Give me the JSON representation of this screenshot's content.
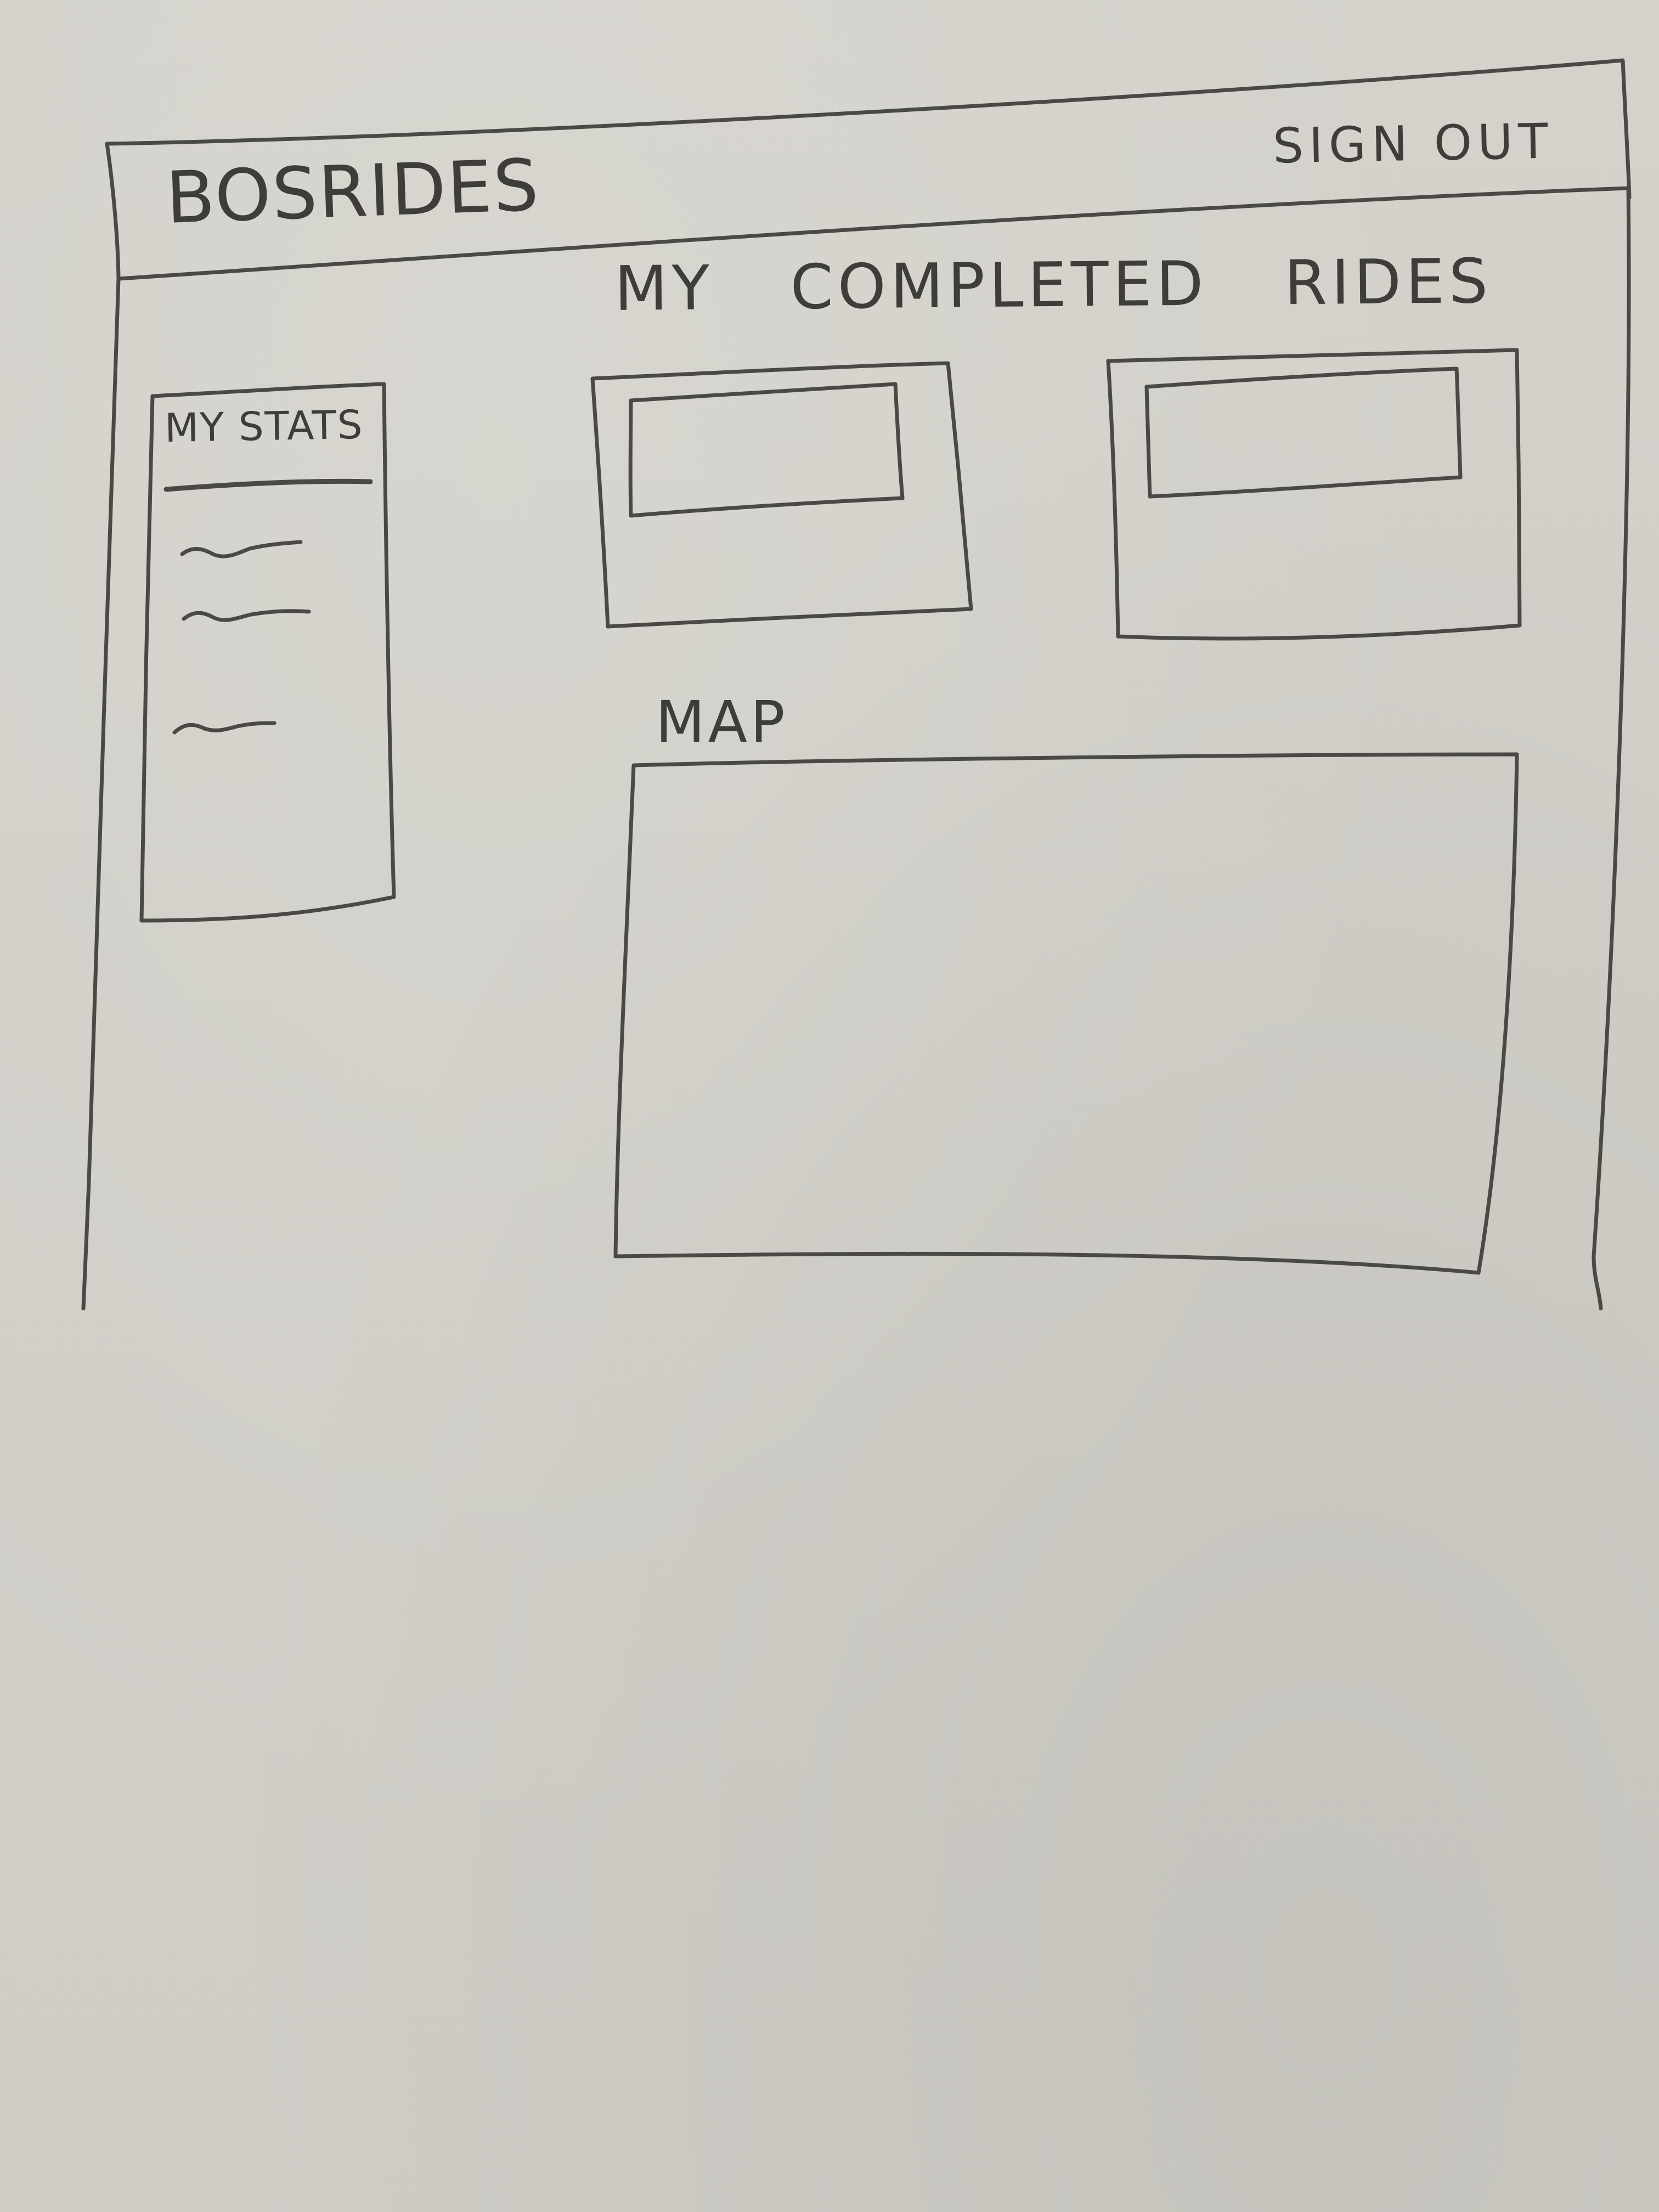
{
  "header": {
    "brand": "BOSRIDES",
    "sign_out_label": "SIGN OUT"
  },
  "stats_panel": {
    "title": "MY STATS",
    "stat_line_count_visible": 3
  },
  "completed_rides": {
    "heading_words": [
      "MY",
      "COMPLETED",
      "RIDES"
    ],
    "card_count": 2
  },
  "map": {
    "title": "MAP"
  }
}
